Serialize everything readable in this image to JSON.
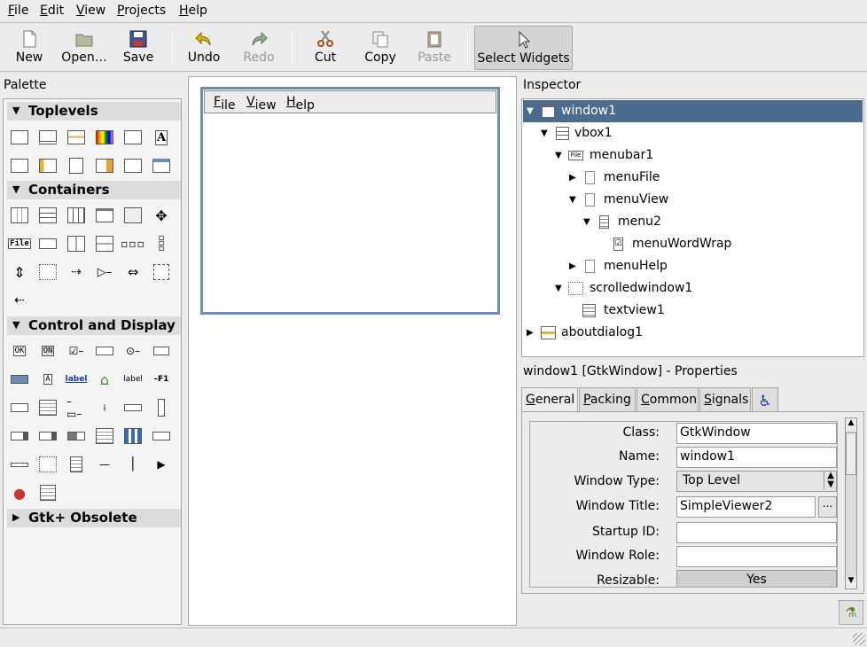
{
  "menubar": {
    "items": [
      {
        "label": "File",
        "key": "F",
        "rest": "ile"
      },
      {
        "label": "Edit",
        "key": "E",
        "rest": "dit"
      },
      {
        "label": "View",
        "key": "V",
        "rest": "iew"
      },
      {
        "label": "Projects",
        "key": "P",
        "rest": "rojects"
      },
      {
        "label": "Help",
        "key": "H",
        "rest": "elp"
      }
    ]
  },
  "toolbar": {
    "new": "New",
    "open": "Open…",
    "save": "Save",
    "undo": "Undo",
    "redo": "Redo",
    "cut": "Cut",
    "copy": "Copy",
    "paste": "Paste",
    "select_widgets": "Select Widgets"
  },
  "palette": {
    "title": "Palette",
    "sections": {
      "toplevels": "Toplevels",
      "containers": "Containers",
      "control_display": "Control and Display",
      "obsolete": "Gtk+ Obsolete"
    },
    "icon_texts": {
      "ok": "OK",
      "on": "ON",
      "a": "A",
      "label_link": "label",
      "label": "label",
      "f1": "F1",
      "file": "File"
    }
  },
  "design": {
    "menu": {
      "file_key": "F",
      "file_rest": "ile",
      "view_key": "V",
      "view_rest": "iew",
      "help_key": "H",
      "help_rest": "elp"
    }
  },
  "inspector": {
    "title": "Inspector",
    "tree": [
      {
        "label": "window1",
        "selected": true
      },
      {
        "label": "vbox1"
      },
      {
        "label": "menubar1"
      },
      {
        "label": "menuFile"
      },
      {
        "label": "menuView"
      },
      {
        "label": "menu2"
      },
      {
        "label": "menuWordWrap"
      },
      {
        "label": "menuHelp"
      },
      {
        "label": "scrolledwindow1"
      },
      {
        "label": "textview1"
      },
      {
        "label": "aboutdialog1"
      }
    ],
    "file_icon_text": "File"
  },
  "properties": {
    "title": "window1 [GtkWindow] - Properties",
    "tabs": [
      {
        "key": "G",
        "rest": "eneral",
        "active": true
      },
      {
        "key": "P",
        "rest": "acking"
      },
      {
        "key": "C",
        "rest": "ommon"
      },
      {
        "key": "S",
        "rest": "ignals"
      }
    ],
    "fields": [
      {
        "label": "Class:",
        "value": "GtkWindow"
      },
      {
        "label": "Name:",
        "value": "window1"
      },
      {
        "label": "Window Type:",
        "value": "Top Level"
      },
      {
        "label": "Window Title:",
        "value": "SimpleViewer2"
      },
      {
        "label": "Startup ID:",
        "value": ""
      },
      {
        "label": "Window Role:",
        "value": ""
      },
      {
        "label": "Resizable:",
        "value": "Yes"
      }
    ],
    "ellipsis": "..."
  }
}
